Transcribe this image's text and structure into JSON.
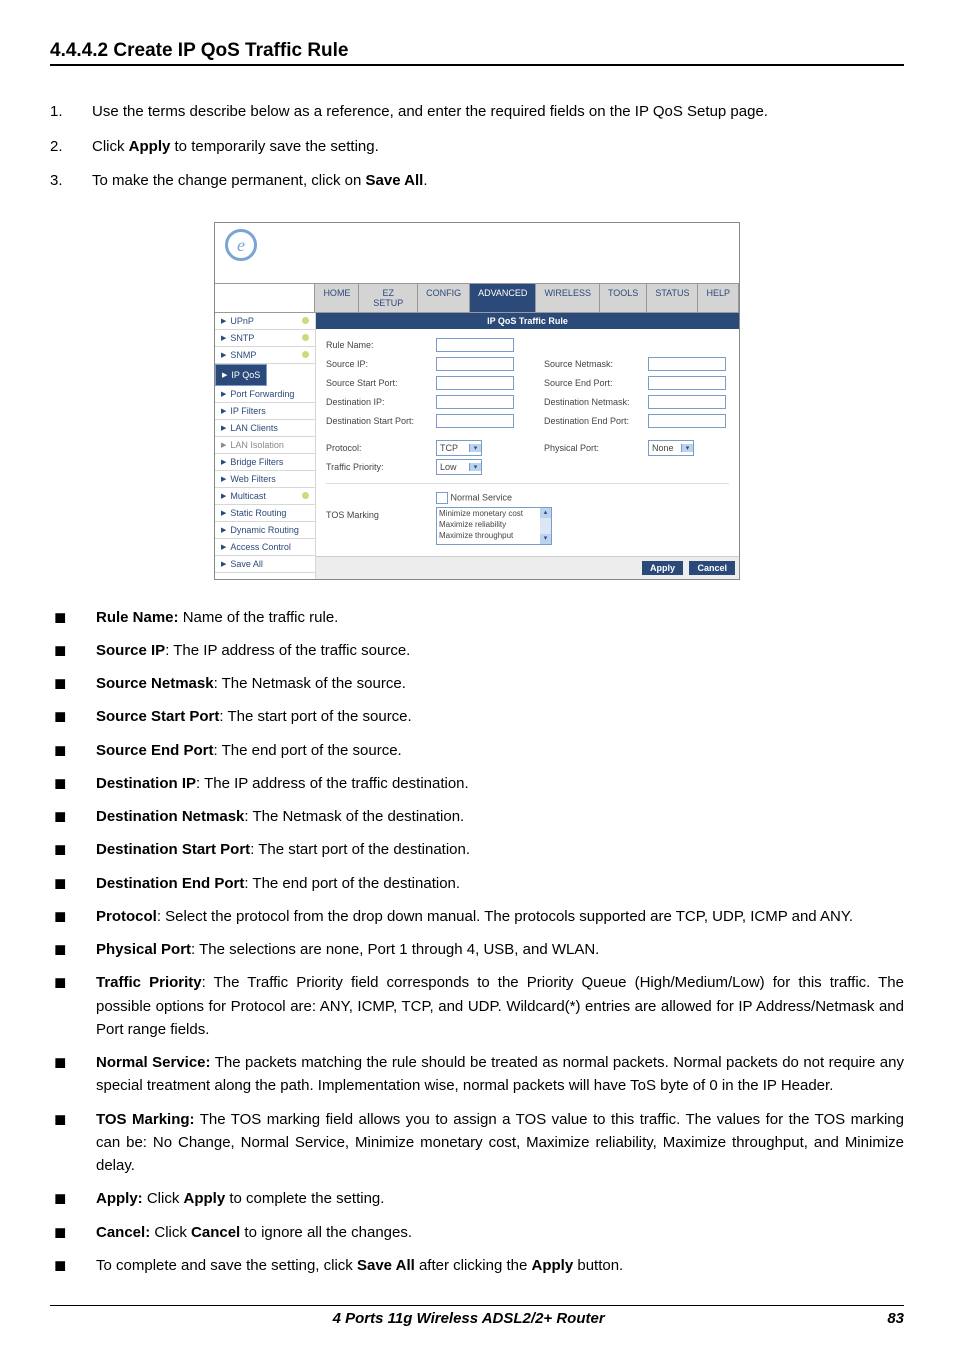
{
  "section_title": "4.4.4.2 Create IP QoS Traffic Rule",
  "steps": [
    {
      "n": "1.",
      "t": "Use the terms describe below as a reference, and enter the required fields on the IP QoS Setup page."
    },
    {
      "n": "2.",
      "pre": "Click ",
      "b": "Apply",
      "post": " to temporarily save the setting."
    },
    {
      "n": "3.",
      "pre": "To make the change permanent, click on ",
      "b": "Save All",
      "post": "."
    }
  ],
  "ui": {
    "logo": "e",
    "tabs": [
      "HOME",
      "EZ SETUP",
      "CONFIG",
      "ADVANCED",
      "WIRELESS",
      "TOOLS",
      "STATUS",
      "HELP"
    ],
    "active_tab": "ADVANCED",
    "side": [
      {
        "t": "UPnP",
        "c": true
      },
      {
        "t": "SNTP",
        "c": true
      },
      {
        "t": "SNMP",
        "c": true
      },
      {
        "t": "IP QoS",
        "sel": true
      },
      {
        "t": "Port Forwarding"
      },
      {
        "t": "IP Filters"
      },
      {
        "t": "LAN Clients"
      },
      {
        "t": "LAN Isolation",
        "dim": true
      },
      {
        "t": "Bridge Filters"
      },
      {
        "t": "Web Filters"
      },
      {
        "t": "Multicast",
        "c": true
      },
      {
        "t": "Static Routing"
      },
      {
        "t": "Dynamic Routing"
      },
      {
        "t": "Access Control"
      },
      {
        "t": "Save All"
      }
    ],
    "panel_title": "IP QoS Traffic Rule",
    "lbl": {
      "rule_name": "Rule Name:",
      "source_ip": "Source IP:",
      "source_netmask": "Source Netmask:",
      "source_start": "Source Start Port:",
      "source_end": "Source End Port:",
      "dest_ip": "Destination IP:",
      "dest_netmask": "Destination Netmask:",
      "dest_start": "Destination Start Port:",
      "dest_end": "Destination End Port:",
      "protocol": "Protocol:",
      "physical_port": "Physical Port:",
      "traffic_priority": "Traffic Priority:",
      "normal_service": "Normal Service",
      "tos": "TOS Marking"
    },
    "protocol_val": "TCP",
    "physical_val": "None",
    "priority_val": "Low",
    "tos_list": [
      "Minimize monetary cost",
      "Maximize reliability",
      "Maximize throughput"
    ],
    "apply": "Apply",
    "cancel": "Cancel"
  },
  "defs": [
    {
      "b": "Rule Name:",
      "t": " Name of the traffic rule."
    },
    {
      "b": "Source IP",
      "t": ": The IP address of the traffic source."
    },
    {
      "b": "Source Netmask",
      "t": ": The Netmask of the source."
    },
    {
      "b": "Source Start Port",
      "t": ": The start port of the source."
    },
    {
      "b": "Source End Port",
      "t": ": The end port of the source."
    },
    {
      "b": "Destination IP",
      "t": ": The IP address of the traffic destination."
    },
    {
      "b": "Destination Netmask",
      "t": ": The Netmask of the destination."
    },
    {
      "b": "Destination Start Port",
      "t": ": The start port of the destination."
    },
    {
      "b": "Destination End Port",
      "t": ": The end port of the destination."
    },
    {
      "b": "Protocol",
      "t": ": Select the protocol from the drop down manual. The protocols supported are TCP, UDP, ICMP and ANY."
    },
    {
      "b": "Physical Port",
      "t": ": The selections are none, Port 1 through 4, USB, and WLAN."
    },
    {
      "b": "Traffic Priority",
      "t": ": The Traffic Priority field corresponds to the Priority Queue (High/Medium/Low) for this traffic. The possible options for Protocol are: ANY, ICMP, TCP, and UDP. Wildcard(*) entries are allowed for IP Address/Netmask and Port range fields."
    },
    {
      "b": "Normal Service:",
      "t": " The packets matching the rule should be treated as normal packets. Normal packets do not require any special treatment along the path. Implementation wise, normal packets will have ToS byte of 0 in the IP Header."
    },
    {
      "b": "TOS Marking:",
      "t": " The TOS marking field allows you to assign a TOS value to this traffic. The values for the TOS marking can be: No Change, Normal Service, Minimize monetary cost, Maximize reliability, Maximize throughput, and Minimize delay."
    },
    {
      "b": "Apply:",
      "pre": " Click ",
      "b2": "Apply",
      "post": " to complete the setting."
    },
    {
      "b": "Cancel:",
      "pre": " Click ",
      "b2": "Cancel",
      "post": " to ignore all the changes."
    },
    {
      "pre": "To complete and save the setting, click ",
      "b2": "Save All",
      "mid": " after clicking the ",
      "b3": "Apply",
      "post": " button."
    }
  ],
  "footer": {
    "l": "4 Ports 11g Wireless ADSL2/2+ Router",
    "r": "83"
  }
}
